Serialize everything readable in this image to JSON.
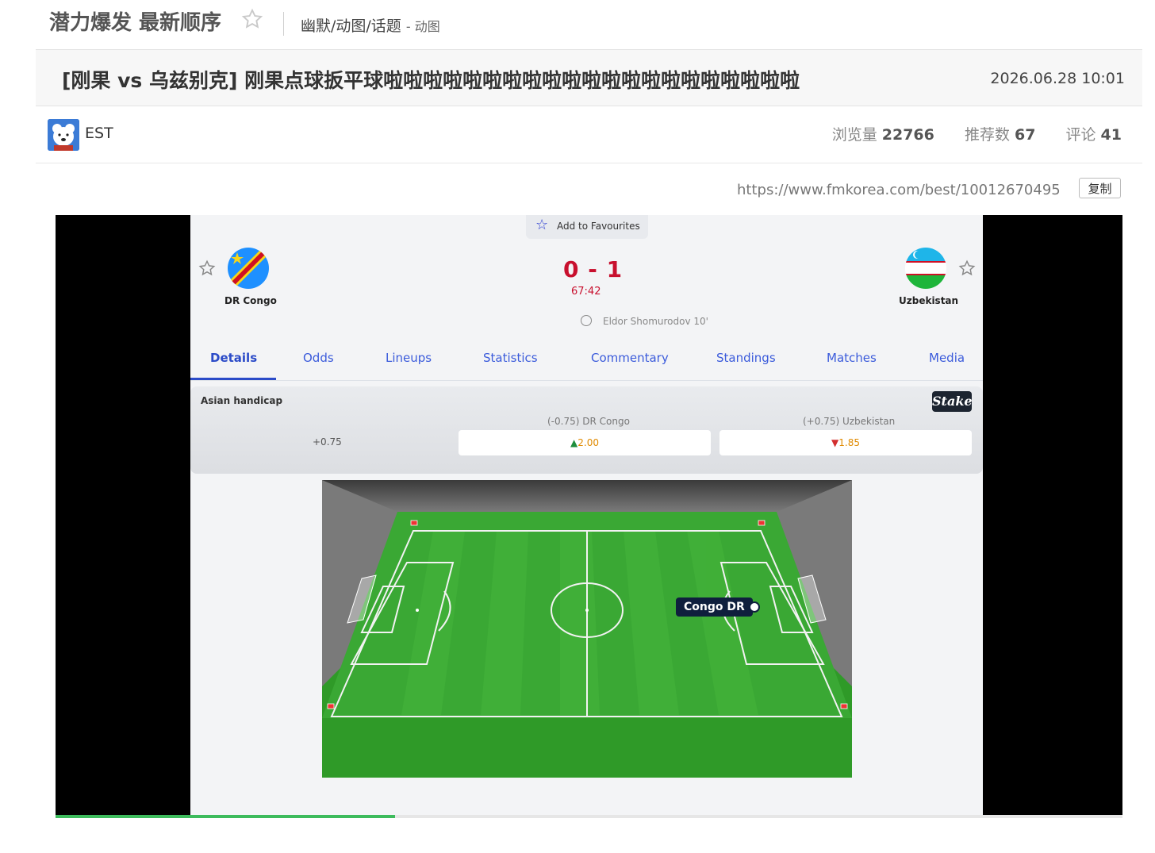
{
  "header": {
    "board_title": "潜力爆发 最新顺序",
    "breadcrumb": "幽默/动图/话题",
    "breadcrumb_sub": "- 动图"
  },
  "post": {
    "title": "[刚果 vs 乌兹别克] 刚果点球扳平球啦啦啦啦啦啦啦啦啦啦啦啦啦啦啦啦啦啦啦啦啦",
    "date": "2026.06.28 10:01",
    "author": "EST",
    "views_label": "浏览量",
    "views": "22766",
    "recommend_label": "推荐数",
    "recommend": "67",
    "comments_label": "评论",
    "comments": "41",
    "url": "https://www.fmkorea.com/best/10012670495",
    "copy_label": "复制"
  },
  "video": {
    "progress_fraction": 0.318,
    "fav_label": "Add to Favourites",
    "home_team": "DR Congo",
    "away_team": "Uzbekistan",
    "score": "0 - 1",
    "clock": "67:42",
    "scorer": "Eldor Shomurodov 10'",
    "tabs": [
      "Details",
      "Odds",
      "Lineups",
      "Statistics",
      "Commentary",
      "Standings",
      "Matches",
      "Media"
    ],
    "odds": {
      "title": "Asian handicap",
      "brand": "Stake",
      "line": "+0.75",
      "home_head": "(-0.75) DR Congo",
      "home_odd": "2.00",
      "away_head": "(+0.75) Uzbekistan",
      "away_odd": "1.85"
    },
    "attacking_team_tag": "Congo DR"
  },
  "colors": {
    "accent": "#2b4bc8",
    "score": "#c8102e",
    "pitch": "#32a42b",
    "progress": "#3dbb5c"
  }
}
